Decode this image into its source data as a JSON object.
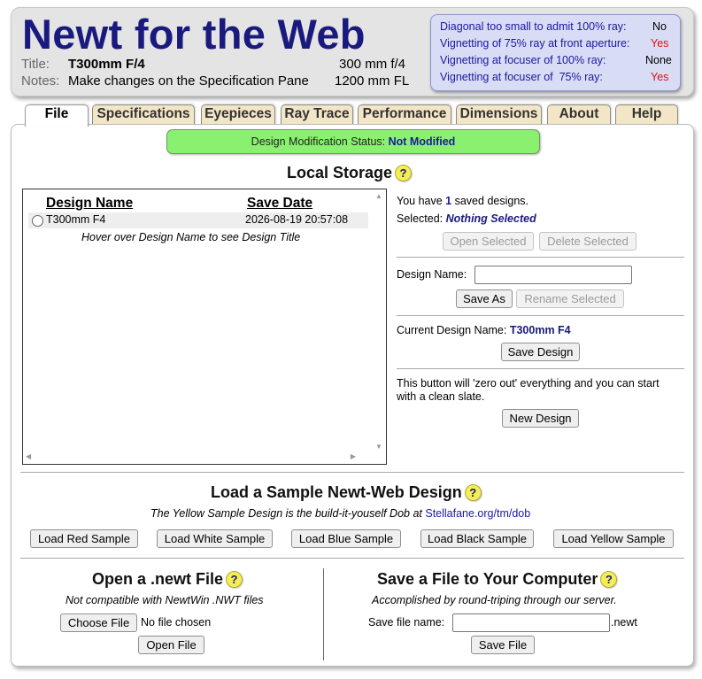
{
  "header": {
    "app_title": "Newt for the Web",
    "title_label": "Title:",
    "title_value": "T300mm F/4",
    "notes_label": "Notes:",
    "notes_value": "Make changes on the Specification Pane",
    "f_ratio": "300 mm f/4",
    "focal_length": "1200 mm FL"
  },
  "vignetting": [
    {
      "label": "Diagonal too small to admit 100% ray:",
      "value": "No",
      "value_color": "#000000"
    },
    {
      "label": "Vignetting of 75% ray at front aperture:",
      "value": "Yes",
      "value_color": "#e01010"
    },
    {
      "label": "Vignetting at focuser of 100% ray:",
      "value": "None",
      "value_color": "#000000"
    },
    {
      "label": "Vignetting at focuser of  75% ray:",
      "value": "Yes",
      "value_color": "#e01010"
    }
  ],
  "tabs": [
    {
      "label": "File",
      "active": true
    },
    {
      "label": "Specifications",
      "active": false
    },
    {
      "label": "Eyepieces",
      "active": false
    },
    {
      "label": "Ray Trace",
      "active": false
    },
    {
      "label": "Performance",
      "active": false
    },
    {
      "label": "Dimensions",
      "active": false
    },
    {
      "label": "About",
      "active": false
    },
    {
      "label": "Help",
      "active": false
    }
  ],
  "status": {
    "label": "Design Modification Status:",
    "value": "Not Modified",
    "bg_color": "#8af070"
  },
  "local_storage": {
    "title": "Local Storage",
    "help": "?",
    "col_name": "Design Name",
    "col_date": "Save Date",
    "designs": [
      {
        "name": "T300mm F4",
        "date": "2026-08-19 20:57:08",
        "selected": false
      }
    ],
    "hover_hint": "Hover over Design Name to see Design Title",
    "saved_prefix": "You have",
    "saved_count": "1",
    "saved_suffix": "saved designs.",
    "selected_label": "Selected:",
    "selected_value": "Nothing Selected",
    "open_selected": "Open Selected",
    "delete_selected": "Delete Selected",
    "design_name_label": "Design Name:",
    "design_name_value": "",
    "save_as": "Save As",
    "rename_selected": "Rename Selected",
    "current_label": "Current Design Name:",
    "current_value": "T300mm F4",
    "save_design": "Save Design",
    "zero_text_1": "This button will 'zero out' everything and you can start",
    "zero_text_2": "with a clean slate.",
    "new_design": "New Design"
  },
  "samples": {
    "title": "Load a Sample Newt-Web Design",
    "help": "?",
    "note_prefix": "The Yellow Sample Design is the build-it-youself Dob at",
    "note_link": "Stellafane.org/tm/dob",
    "buttons": [
      "Load Red Sample",
      "Load White Sample",
      "Load Blue Sample",
      "Load Black Sample",
      "Load Yellow Sample"
    ]
  },
  "open_file": {
    "title": "Open a .newt File",
    "help": "?",
    "note": "Not compatible with NewtWin .NWT files",
    "choose_button": "Choose File",
    "no_file": "No file chosen",
    "open_button": "Open File"
  },
  "save_file": {
    "title": "Save a File to Your Computer",
    "help": "?",
    "note": "Accomplished by round-triping through our server.",
    "name_label": "Save file name:",
    "name_value": "",
    "extension": ".newt",
    "save_button": "Save File"
  },
  "colors": {
    "title_blue": "#1a1a7e",
    "tab_bg": "#f3e6c6",
    "help_yellow": "#f4ee55",
    "warning_red": "#e01010"
  }
}
